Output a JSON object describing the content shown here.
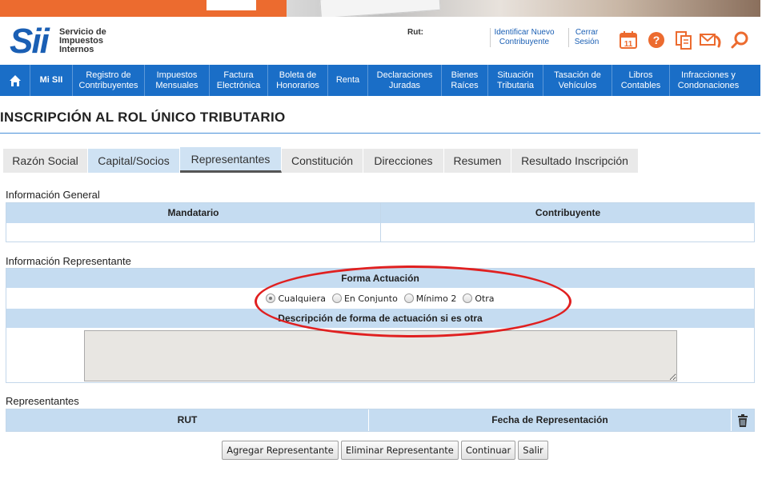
{
  "header": {
    "logo": {
      "main": "Sii",
      "line1": "Servicio de",
      "line2": "Impuestos",
      "line3": "Internos"
    },
    "rut_label": "Rut:",
    "links": {
      "identify_line1": "Identificar Nuevo",
      "identify_line2": "Contribuyente",
      "logout_line1": "Cerrar",
      "logout_line2": "Sesión"
    },
    "icons": [
      "calendar-icon",
      "help-icon",
      "documents-icon",
      "mail-phone-icon",
      "search-icon"
    ],
    "calendar_day": "11"
  },
  "nav": {
    "home_icon": "home-icon",
    "items": [
      {
        "l1": "Mi SII",
        "l2": ""
      },
      {
        "l1": "Registro de",
        "l2": "Contribuyentes"
      },
      {
        "l1": "Impuestos",
        "l2": "Mensuales"
      },
      {
        "l1": "Factura",
        "l2": "Electrónica"
      },
      {
        "l1": "Boleta de",
        "l2": "Honorarios"
      },
      {
        "l1": "Renta",
        "l2": ""
      },
      {
        "l1": "Declaraciones",
        "l2": "Juradas"
      },
      {
        "l1": "Bienes",
        "l2": "Raíces"
      },
      {
        "l1": "Situación",
        "l2": "Tributaria"
      },
      {
        "l1": "Tasación de",
        "l2": "Vehículos"
      },
      {
        "l1": "Libros",
        "l2": "Contables"
      },
      {
        "l1": "Infracciones y",
        "l2": "Condonaciones"
      }
    ]
  },
  "page": {
    "title": "INSCRIPCIÓN AL ROL ÚNICO TRIBUTARIO"
  },
  "tabs": [
    "Razón Social",
    "Capital/Socios",
    "Representantes",
    "Constitución",
    "Direcciones",
    "Resumen",
    "Resultado Inscripción"
  ],
  "active_tab": "Representantes",
  "general": {
    "label": "Información General",
    "col1": "Mandatario",
    "col2": "Contribuyente"
  },
  "representante": {
    "label": "Información Representante",
    "forma_header": "Forma Actuación",
    "options": [
      "Cualquiera",
      "En Conjunto",
      "Mínimo 2",
      "Otra"
    ],
    "selected": "Cualquiera",
    "descripcion_header": "Descripción de forma de actuación si es otra",
    "descripcion_value": ""
  },
  "representantes": {
    "label": "Representantes",
    "col1": "RUT",
    "col2": "Fecha de Representación",
    "delete_icon": "trash-icon"
  },
  "buttons": {
    "add": "Agregar Representante",
    "remove": "Eliminar Representante",
    "continue": "Continuar",
    "exit": "Salir"
  },
  "colors": {
    "nav": "#1a6ec7",
    "header_cell": "#c5dcf1",
    "brand_orange": "#ec6b2f",
    "annotation": "#e02020"
  }
}
